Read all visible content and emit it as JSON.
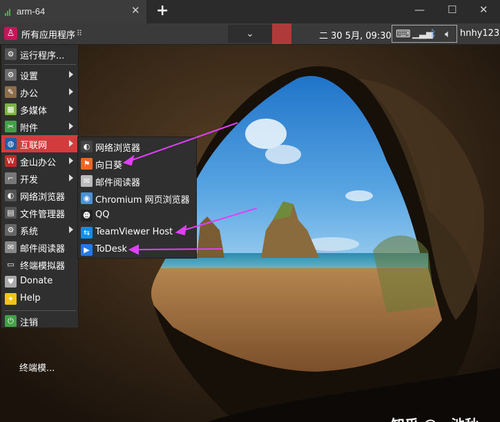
{
  "tab": {
    "title": "arm-64",
    "close": "✕",
    "new": "+"
  },
  "window_controls": {
    "minimize": "—",
    "maximize": "☐",
    "close": "✕"
  },
  "panel": {
    "start_label": "所有应用程序",
    "dots": "⠿",
    "dropdown_glyph": "⌄",
    "clock": "二 30 5月, 09:30",
    "user": "hnhy123",
    "accent_color": "#d23c3c"
  },
  "main_menu": {
    "items": [
      {
        "label": "运行程序...",
        "icon": "gear-run-icon",
        "glyph": "⚙",
        "color": "#555"
      },
      {
        "label": "设置",
        "icon": "settings-icon",
        "glyph": "⚙",
        "color": "#6b6b6b",
        "arrow": true
      },
      {
        "label": "办公",
        "icon": "office-icon",
        "glyph": "✎",
        "color": "#8d6e4a",
        "arrow": true
      },
      {
        "label": "多媒体",
        "icon": "multimedia-icon",
        "glyph": "▦",
        "color": "#7cb342",
        "arrow": true
      },
      {
        "label": "附件",
        "icon": "accessories-icon",
        "glyph": "✂",
        "color": "#43a047",
        "arrow": true
      },
      {
        "label": "互联网",
        "icon": "internet-icon",
        "glyph": "◍",
        "color": "#1e5fa8",
        "arrow": true,
        "active": true
      },
      {
        "label": "金山办公",
        "icon": "wps-icon",
        "glyph": "W",
        "color": "#c62828",
        "arrow": true
      },
      {
        "label": "开发",
        "icon": "development-icon",
        "glyph": "⌐",
        "color": "#777",
        "arrow": true
      },
      {
        "label": "网络浏览器",
        "icon": "web-browser-icon",
        "glyph": "◐",
        "color": "#555"
      },
      {
        "label": "文件管理器",
        "icon": "file-manager-icon",
        "glyph": "▤",
        "color": "#555"
      },
      {
        "label": "系统",
        "icon": "system-icon",
        "glyph": "⚙",
        "color": "#666",
        "arrow": true
      },
      {
        "label": "邮件阅读器",
        "icon": "mail-icon",
        "glyph": "✉",
        "color": "#888"
      },
      {
        "label": "终端模拟器",
        "icon": "terminal-icon",
        "glyph": "▭",
        "color": "#333"
      },
      {
        "label": "Donate",
        "icon": "donate-icon",
        "glyph": "♥",
        "color": "#aaa"
      },
      {
        "label": "Help",
        "icon": "help-icon",
        "glyph": "✦",
        "color": "#f0c419"
      },
      {
        "label": "注销",
        "icon": "logout-icon",
        "glyph": "⏻",
        "color": "#43a047"
      }
    ]
  },
  "sub_menu": {
    "items": [
      {
        "label": "网络浏览器",
        "icon": "web-browser-icon",
        "glyph": "◐",
        "color": "#444"
      },
      {
        "label": "向日葵",
        "icon": "sunflower-icon",
        "glyph": "⚑",
        "color": "#f26522"
      },
      {
        "label": "邮件阅读器",
        "icon": "mail-icon",
        "glyph": "✉",
        "color": "#bbb"
      },
      {
        "label": "Chromium 网页浏览器",
        "icon": "chromium-icon",
        "glyph": "◉",
        "color": "#4a90d9"
      },
      {
        "label": "QQ",
        "icon": "qq-penguin-icon",
        "glyph": "☻",
        "color": "#222"
      },
      {
        "label": "TeamViewer Host",
        "icon": "teamviewer-icon",
        "glyph": "⇆",
        "color": "#0e8ee9"
      },
      {
        "label": "ToDesk",
        "icon": "todesk-icon",
        "glyph": "▶",
        "color": "#1d7af3"
      }
    ]
  },
  "desktop": {
    "icon_label": "终端模..."
  },
  "watermark": "知乎 @一池秋",
  "annotation_color": "#e040fb"
}
